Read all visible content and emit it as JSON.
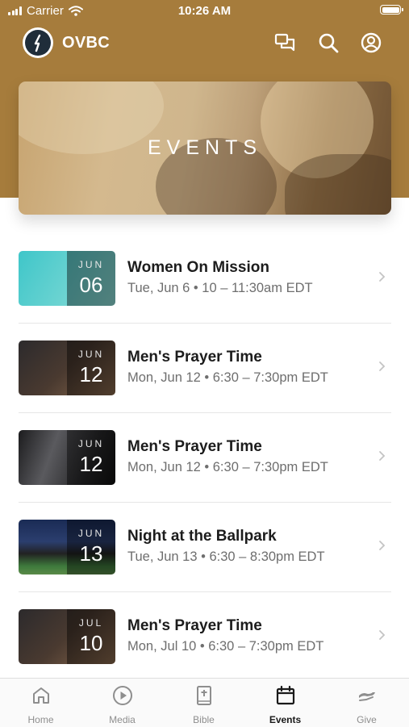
{
  "status_bar": {
    "carrier": "Carrier",
    "time": "10:26 AM"
  },
  "app": {
    "name": "OVBC"
  },
  "header_icons": [
    "chat-icon",
    "search-icon",
    "profile-icon"
  ],
  "hero": {
    "title": "EVENTS"
  },
  "events": [
    {
      "title": "Women On Mission",
      "subtitle": "Tue, Jun 6 • 10 – 11:30am EDT",
      "month": "JUN",
      "day": "06",
      "thumb_colors": [
        "#3fc6c9",
        "#8fded8"
      ]
    },
    {
      "title": "Men's Prayer Time",
      "subtitle": "Mon, Jun 12 • 6:30 – 7:30pm EDT",
      "month": "JUN",
      "day": "12",
      "thumb_colors": [
        "#2c2a2c",
        "#8b6a4e"
      ]
    },
    {
      "title": "Men's Prayer Time",
      "subtitle": "Mon, Jun 12 • 6:30 – 7:30pm EDT",
      "month": "JUN",
      "day": "12",
      "thumb_colors": [
        "#1c1c1e",
        "#5a5a5e"
      ]
    },
    {
      "title": "Night at the Ballpark",
      "subtitle": "Tue, Jun 13 • 6:30 – 8:30pm EDT",
      "month": "JUN",
      "day": "13",
      "thumb_colors": [
        "#1a2b55",
        "#3e7a3c"
      ]
    },
    {
      "title": "Men's Prayer Time",
      "subtitle": "Mon, Jul 10 • 6:30 – 7:30pm EDT",
      "month": "JUL",
      "day": "10",
      "thumb_colors": [
        "#2c2a2c",
        "#8b6a4e"
      ]
    }
  ],
  "tabs": [
    {
      "label": "Home",
      "icon": "home-icon",
      "active": false
    },
    {
      "label": "Media",
      "icon": "play-icon",
      "active": false
    },
    {
      "label": "Bible",
      "icon": "bible-icon",
      "active": false
    },
    {
      "label": "Events",
      "icon": "calendar-icon",
      "active": true
    },
    {
      "label": "Give",
      "icon": "give-icon",
      "active": false
    }
  ],
  "colors": {
    "brand": "#a67c3c",
    "tab_active": "#1a1a1a",
    "tab_inactive": "#8e8e8e"
  }
}
